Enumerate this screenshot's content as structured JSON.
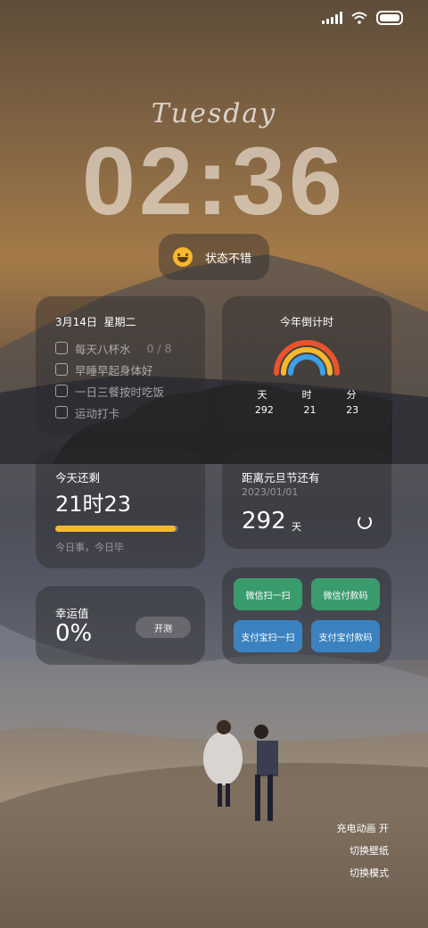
{
  "lockscreen": {
    "day": "Tuesday",
    "time": "02:36"
  },
  "mood": {
    "label": "状态不错",
    "icon": "smiley-icon"
  },
  "todo": {
    "date": "3月14日",
    "weekday": "星期二",
    "items": [
      {
        "label": "每天八杯水",
        "count": "0 / 8"
      },
      {
        "label": "早睡早起身体好",
        "count": ""
      },
      {
        "label": "一日三餐按时吃饭",
        "count": ""
      },
      {
        "label": "运动打卡",
        "count": ""
      }
    ]
  },
  "year_countdown": {
    "title": "今年倒计时",
    "units": [
      "天",
      "时",
      "分"
    ],
    "values": [
      "292",
      "21",
      "23"
    ],
    "ring_colors": [
      "#e8542e",
      "#f5b82e",
      "#3ba0e8"
    ]
  },
  "today_remaining": {
    "label": "今天还剩",
    "value": "21时23",
    "progress_fraction": 0.98,
    "subtitle": "今日事，今日毕",
    "bar_color": "#f5b82e"
  },
  "new_year": {
    "label": "距离元旦节还有",
    "date": "2023/01/01",
    "days": "292",
    "unit": "天"
  },
  "lucky": {
    "label": "幸运值",
    "value": "0%",
    "button": "开测"
  },
  "payments": {
    "wechat_scan": "微信扫一扫",
    "wechat_pay": "微信付款码",
    "alipay_scan": "支付宝扫一扫",
    "alipay_pay": "支付宝付款码",
    "green": "#3a9c6c",
    "blue": "#3b82c0"
  },
  "bottom_actions": {
    "charge_anim": "充电动画 开",
    "switch_wallpaper": "切换壁纸",
    "switch_mode": "切换模式"
  }
}
